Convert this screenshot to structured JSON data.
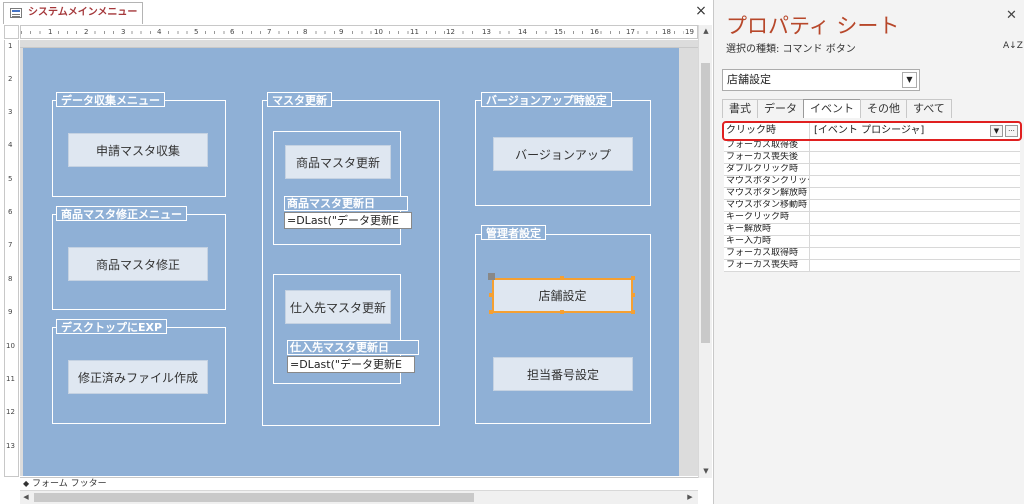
{
  "document": {
    "tab_label": "システムメインメニュー",
    "close_glyph": "×"
  },
  "ruler": {
    "numbers": [
      "1",
      "2",
      "3",
      "4",
      "5",
      "6",
      "7",
      "8",
      "9",
      "10",
      "11",
      "12",
      "13",
      "14",
      "15",
      "16",
      "17",
      "18",
      "19"
    ],
    "vertical_numbers": [
      "1",
      "2",
      "3",
      "4",
      "5",
      "6",
      "7",
      "8",
      "9",
      "10",
      "11",
      "12",
      "13"
    ]
  },
  "form": {
    "groups": {
      "data_collect": "データ収集メニュー",
      "product_fix": "商品マスタ修正メニュー",
      "desktop_exp": "デスクトップにEXP",
      "master_update": "マスタ更新",
      "version_up": "バージョンアップ時設定",
      "admin": "管理者設定"
    },
    "buttons": {
      "apply_collect": "申請マスタ収集",
      "product_fix": "商品マスタ修正",
      "make_fixed_file": "修正済みファイル作成",
      "product_update": "商品マスタ更新",
      "supplier_update": "仕入先マスタ更新",
      "version_up": "バージョンアップ",
      "store_settings": "店舗設定",
      "staff_number": "担当番号設定"
    },
    "labels": {
      "product_update_date": "商品マスタ更新日",
      "supplier_update_date": "仕入先マスタ更新日"
    },
    "textboxes": {
      "product_update_date_expr": "=DLast(\"データ更新E",
      "supplier_update_date_expr": "=DLast(\"データ更新E"
    },
    "footer_section": "フォーム フッター"
  },
  "property_sheet": {
    "title": "プロパティ シート",
    "selection_type": "選択の種類: コマンド ボタン",
    "selected_object": "店舗設定",
    "sort_icon_label": "A↓Z",
    "tabs": [
      "書式",
      "データ",
      "イベント",
      "その他",
      "すべて"
    ],
    "active_tab": "イベント",
    "rows": [
      {
        "name": "クリック時",
        "value": "[イベント プロシージャ]"
      },
      {
        "name": "フォーカス取得後",
        "value": ""
      },
      {
        "name": "フォーカス喪失後",
        "value": ""
      },
      {
        "name": "ダブルクリック時",
        "value": ""
      },
      {
        "name": "マウスボタンクリック時",
        "value": ""
      },
      {
        "name": "マウスボタン解放時",
        "value": ""
      },
      {
        "name": "マウスボタン移動時",
        "value": ""
      },
      {
        "name": "キークリック時",
        "value": ""
      },
      {
        "name": "キー解放時",
        "value": ""
      },
      {
        "name": "キー入力時",
        "value": ""
      },
      {
        "name": "フォーカス取得時",
        "value": ""
      },
      {
        "name": "フォーカス喪失時",
        "value": ""
      }
    ]
  },
  "colors": {
    "form_background": "#8fb0d6",
    "button_face": "#dfe7f1",
    "selection_outline": "#f5a032",
    "title_accent": "#b7472a",
    "highlight_box": "#e02020"
  }
}
